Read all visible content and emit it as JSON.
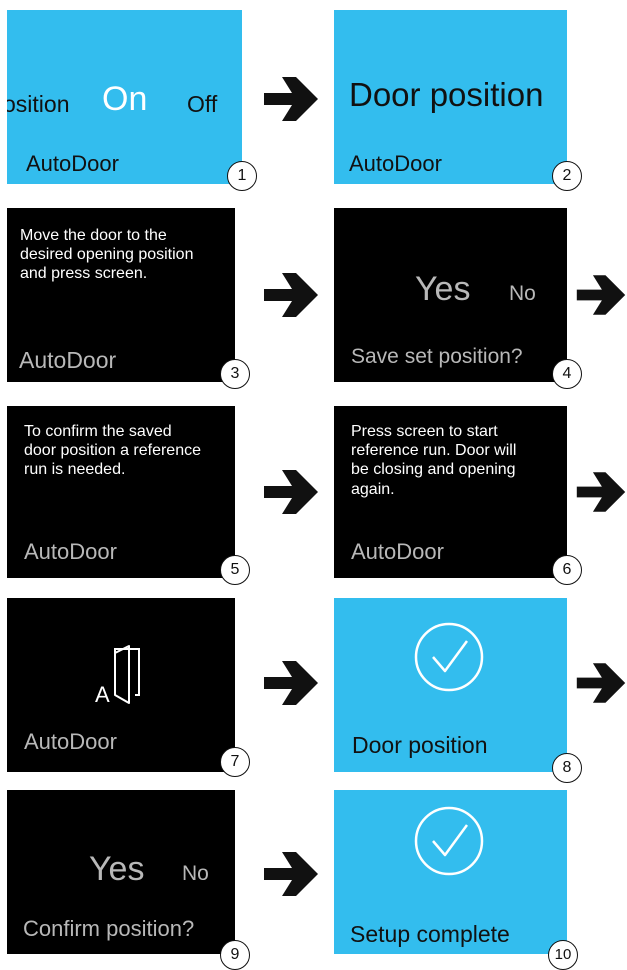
{
  "steps": [
    {
      "number": "1",
      "app_label": "AutoDoor",
      "item_partial": "osition",
      "option_on": "On",
      "option_off": "Off"
    },
    {
      "number": "2",
      "title": "Door position",
      "app_label": "AutoDoor"
    },
    {
      "number": "3",
      "message": "Move the door to the\ndesired opening position\nand press screen.",
      "app_label": "AutoDoor"
    },
    {
      "number": "4",
      "option_yes": "Yes",
      "option_no": "No",
      "prompt": "Save set position?"
    },
    {
      "number": "5",
      "message": "To confirm the saved\ndoor position a reference\nrun is needed.",
      "app_label": "AutoDoor"
    },
    {
      "number": "6",
      "message": "Press screen to start\nreference run. Door will\nbe closing and opening\nagain.",
      "app_label": "AutoDoor"
    },
    {
      "number": "7",
      "icon_letter": "A",
      "icon": "door-icon",
      "app_label": "AutoDoor"
    },
    {
      "number": "8",
      "icon": "checkmark-circle-icon",
      "title": "Door position"
    },
    {
      "number": "9",
      "option_yes": "Yes",
      "option_no": "No",
      "prompt": "Confirm position?"
    },
    {
      "number": "10",
      "icon": "checkmark-circle-icon",
      "title": "Setup complete"
    }
  ],
  "colors": {
    "screen_blue": "#33bdee",
    "screen_black": "#000000",
    "arrow": "#111111"
  }
}
